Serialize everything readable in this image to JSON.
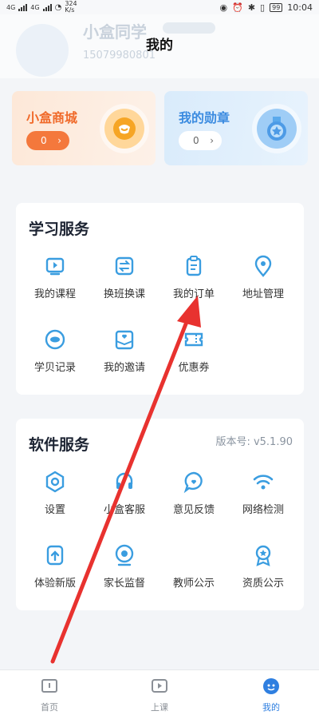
{
  "status": {
    "net1": "4G",
    "net2": "4G",
    "speed": "324 K/s",
    "battery": "99",
    "time": "10:04"
  },
  "header": {
    "title": "我的",
    "user_name": "小盒同学",
    "user_phone": "15079980801"
  },
  "cards": {
    "store": {
      "title": "小盒商城",
      "count": "0",
      "color": "#f06a2a"
    },
    "medal": {
      "title": "我的勋章",
      "count": "0",
      "color": "#3b8be0"
    }
  },
  "learn": {
    "title": "学习服务",
    "items": [
      {
        "label": "我的课程",
        "icon": "play-screen-icon"
      },
      {
        "label": "换班换课",
        "icon": "swap-icon"
      },
      {
        "label": "我的订单",
        "icon": "clipboard-icon"
      },
      {
        "label": "地址管理",
        "icon": "location-pin-icon"
      },
      {
        "label": "学贝记录",
        "icon": "coin-icon"
      },
      {
        "label": "我的邀请",
        "icon": "invite-icon"
      },
      {
        "label": "优惠券",
        "icon": "coupon-icon"
      }
    ]
  },
  "software": {
    "title": "软件服务",
    "version": "版本号: v5.1.90",
    "items": [
      {
        "label": "设置",
        "icon": "hexagon-gear-icon"
      },
      {
        "label": "小盒客服",
        "icon": "headset-icon"
      },
      {
        "label": "意见反馈",
        "icon": "chat-bubble-icon"
      },
      {
        "label": "网络检测",
        "icon": "wifi-icon"
      },
      {
        "label": "体验新版",
        "icon": "upgrade-icon"
      },
      {
        "label": "家长监督",
        "icon": "camera-eye-icon"
      },
      {
        "label": "教师公示",
        "icon": "teacher-icon"
      },
      {
        "label": "资质公示",
        "icon": "award-icon"
      }
    ]
  },
  "tabs": [
    {
      "label": "首页"
    },
    {
      "label": "上课"
    },
    {
      "label": "我的"
    }
  ],
  "accent": "#3a9de0",
  "annotation_color": "#e8322f"
}
